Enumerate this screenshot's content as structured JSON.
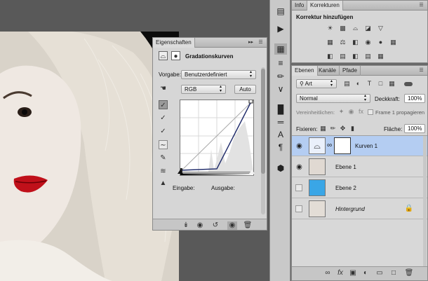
{
  "properties": {
    "tab": "Eigenschaften",
    "heading": "Gradationskurven",
    "preset_label": "Vorgabe:",
    "preset_value": "Benutzerdefiniert",
    "channel_value": "RGB",
    "auto_label": "Auto",
    "input_label": "Eingabe:",
    "output_label": "Ausgabe:"
  },
  "top_right": {
    "tab_info": "Info",
    "tab_korrekturen": "Korrekturen",
    "heading": "Korrektur hinzufügen"
  },
  "layers_panel": {
    "tab_ebenen": "Ebenen",
    "tab_kanaele": "Kanäle",
    "tab_pfade": "Pfade",
    "filter_value": "Art",
    "blend_mode": "Normal",
    "opacity_label": "Deckkraft:",
    "opacity_value": "100%",
    "unify_label": "Vereinheitlichen:",
    "propagate_label": "Frame 1 propagieren",
    "lock_label": "Fixieren:",
    "fill_label": "Fläche:",
    "fill_value": "100%",
    "layers": [
      {
        "name": "Kurven 1",
        "selected": true,
        "visible": true,
        "italic": false
      },
      {
        "name": "Ebene 1",
        "selected": false,
        "visible": true,
        "italic": false
      },
      {
        "name": "Ebene 2",
        "selected": false,
        "visible": false,
        "italic": false
      },
      {
        "name": "Hintergrund",
        "selected": false,
        "visible": false,
        "italic": true
      }
    ]
  },
  "colors": {
    "selected_layer": "#b4cdf2",
    "ebene2_fill": "#3aa6e6",
    "lips": "#c0101a"
  }
}
